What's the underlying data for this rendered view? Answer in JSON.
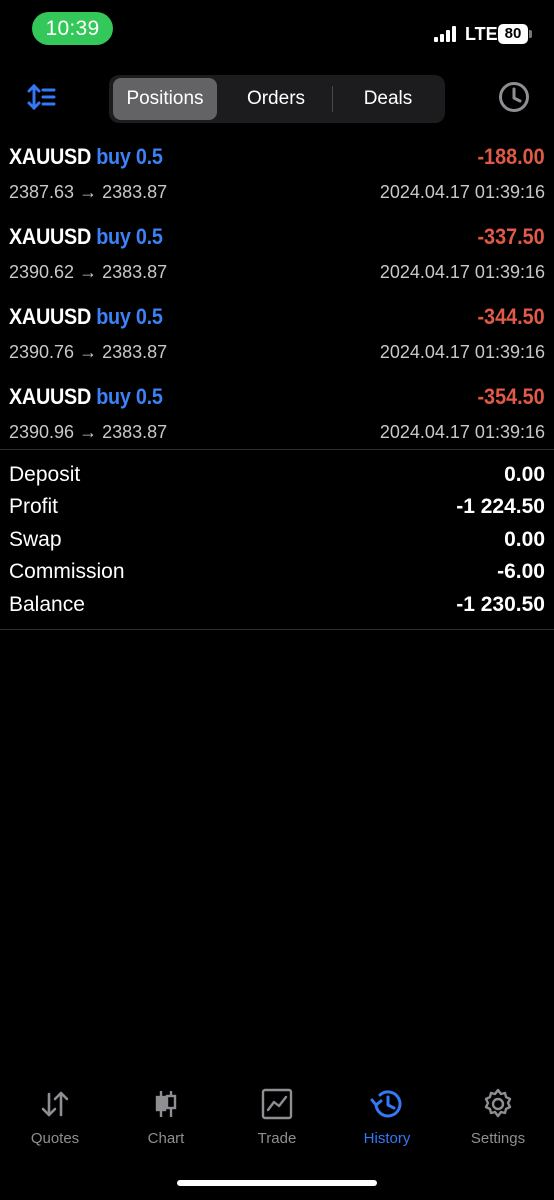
{
  "status_bar": {
    "time": "10:39",
    "network": "LTE",
    "battery": "80"
  },
  "header": {
    "tabs": [
      {
        "label": "Positions",
        "active": true
      },
      {
        "label": "Orders",
        "active": false
      },
      {
        "label": "Deals",
        "active": false
      }
    ],
    "icons": {
      "left": "sort-list-icon",
      "right": "clock-icon"
    }
  },
  "positions": [
    {
      "symbol": "XAUUSD",
      "side": "buy 0.5",
      "profit": "-188.00",
      "prices": "2387.63 → 2383.87",
      "time": "2024.04.17 01:39:16"
    },
    {
      "symbol": "XAUUSD",
      "side": "buy 0.5",
      "profit": "-337.50",
      "prices": "2390.62 → 2383.87",
      "time": "2024.04.17 01:39:16"
    },
    {
      "symbol": "XAUUSD",
      "side": "buy 0.5",
      "profit": "-344.50",
      "prices": "2390.76 → 2383.87",
      "time": "2024.04.17 01:39:16"
    },
    {
      "symbol": "XAUUSD",
      "side": "buy 0.5",
      "profit": "-354.50",
      "prices": "2390.96 → 2383.87",
      "time": "2024.04.17 01:39:16"
    }
  ],
  "summary": [
    {
      "label": "Deposit",
      "value": "0.00"
    },
    {
      "label": "Profit",
      "value": "-1 224.50"
    },
    {
      "label": "Swap",
      "value": "0.00"
    },
    {
      "label": "Commission",
      "value": "-6.00"
    },
    {
      "label": "Balance",
      "value": "-1 230.50"
    }
  ],
  "tabbar": {
    "items": [
      {
        "label": "Quotes",
        "icon": "quotes-arrows-icon",
        "active": false
      },
      {
        "label": "Chart",
        "icon": "candlestick-chart-icon",
        "active": false
      },
      {
        "label": "Trade",
        "icon": "trade-chart-icon",
        "active": false
      },
      {
        "label": "History",
        "icon": "history-clock-icon",
        "active": true
      },
      {
        "label": "Settings",
        "icon": "gear-icon",
        "active": false
      }
    ]
  },
  "colors": {
    "background": "#000000",
    "accent": "#3478f6",
    "loss": "#e05a47",
    "status_pill": "#34c759",
    "buy": "#3b82f6"
  }
}
